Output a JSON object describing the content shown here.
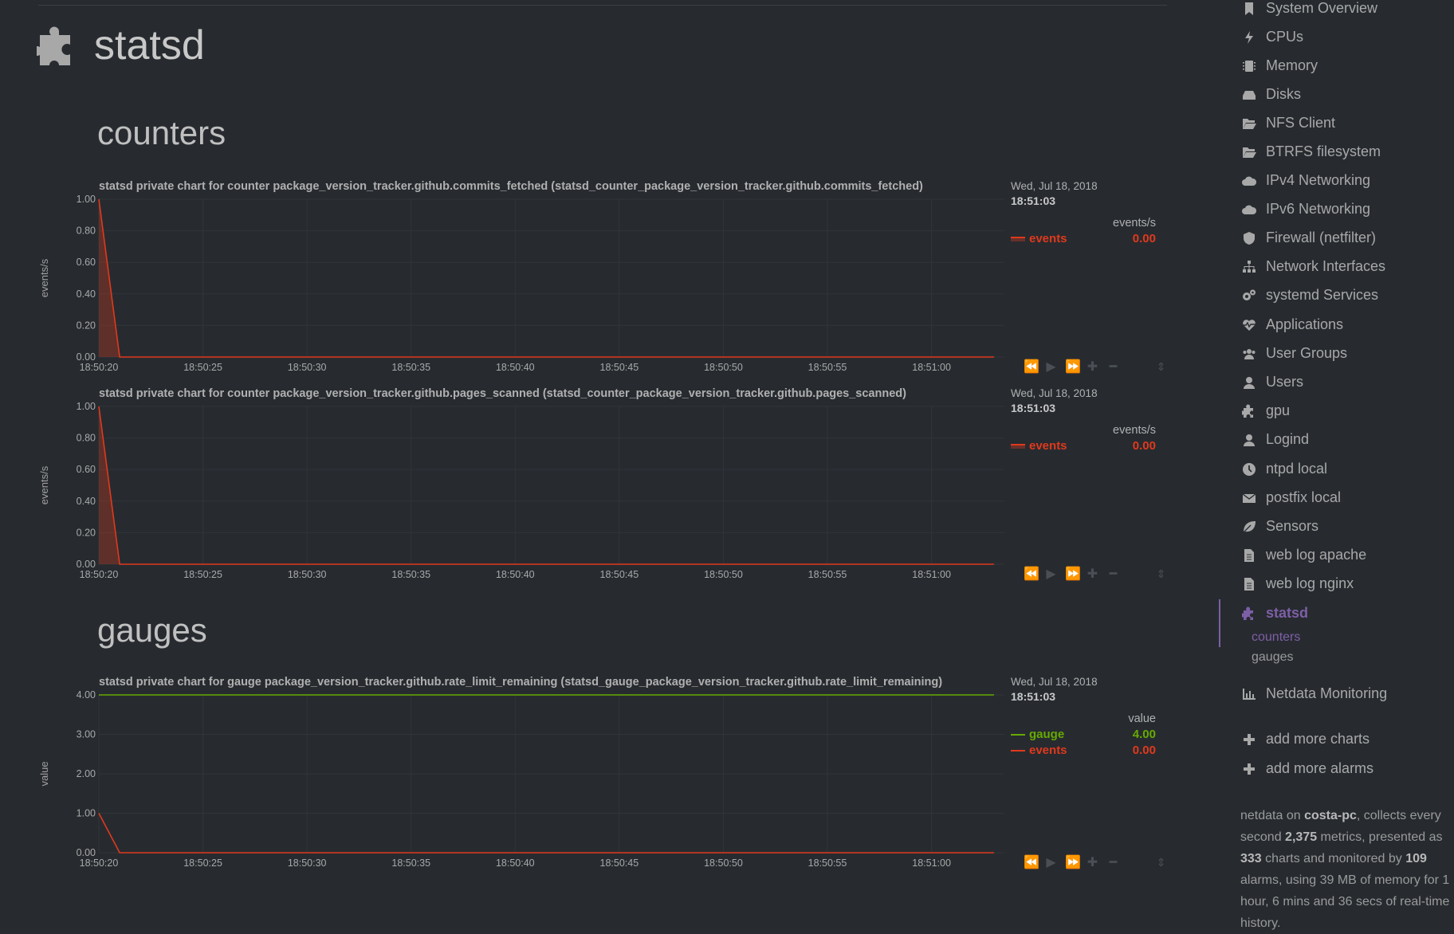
{
  "page": {
    "title": "statsd"
  },
  "sections": {
    "counters": "counters",
    "gauges": "gauges"
  },
  "charts": [
    {
      "title": "statsd private chart for counter package_version_tracker.github.commits_fetched (statsd_counter_package_version_tracker.github.commits_fetched)",
      "ylabel": "events/s",
      "date": "Wed, Jul 18, 2018",
      "time": "18:51:03",
      "units": "events/s",
      "legend": [
        {
          "name": "events",
          "value": "0.00",
          "color": "#e0391c"
        }
      ]
    },
    {
      "title": "statsd private chart for counter package_version_tracker.github.pages_scanned (statsd_counter_package_version_tracker.github.pages_scanned)",
      "ylabel": "events/s",
      "date": "Wed, Jul 18, 2018",
      "time": "18:51:03",
      "units": "events/s",
      "legend": [
        {
          "name": "events",
          "value": "0.00",
          "color": "#e0391c"
        }
      ]
    },
    {
      "title": "statsd private chart for gauge package_version_tracker.github.rate_limit_remaining (statsd_gauge_package_version_tracker.github.rate_limit_remaining)",
      "ylabel": "value",
      "date": "Wed, Jul 18, 2018",
      "time": "18:51:03",
      "units": "value",
      "legend": [
        {
          "name": "gauge",
          "value": "4.00",
          "color": "#66aa00"
        },
        {
          "name": "events",
          "value": "0.00",
          "color": "#e0391c"
        }
      ]
    }
  ],
  "chart_data": [
    {
      "type": "area",
      "ylim": [
        0,
        1
      ],
      "yticks": [
        "0.00",
        "0.20",
        "0.40",
        "0.60",
        "0.80",
        "1.00"
      ],
      "xticks": [
        "18:50:20",
        "18:50:25",
        "18:50:30",
        "18:50:35",
        "18:50:40",
        "18:50:45",
        "18:50:50",
        "18:50:55",
        "18:51:00"
      ],
      "series": [
        {
          "name": "events",
          "color": "#e0391c",
          "x": [
            "18:50:20",
            "18:50:21",
            "18:51:03"
          ],
          "values": [
            1.0,
            0.0,
            0.0
          ]
        }
      ]
    },
    {
      "type": "area",
      "ylim": [
        0,
        1
      ],
      "yticks": [
        "0.00",
        "0.20",
        "0.40",
        "0.60",
        "0.80",
        "1.00"
      ],
      "xticks": [
        "18:50:20",
        "18:50:25",
        "18:50:30",
        "18:50:35",
        "18:50:40",
        "18:50:45",
        "18:50:50",
        "18:50:55",
        "18:51:00"
      ],
      "series": [
        {
          "name": "events",
          "color": "#e0391c",
          "x": [
            "18:50:20",
            "18:50:21",
            "18:51:03"
          ],
          "values": [
            1.0,
            0.0,
            0.0
          ]
        }
      ]
    },
    {
      "type": "line",
      "ylim": [
        0,
        4
      ],
      "yticks": [
        "0.00",
        "1.00",
        "2.00",
        "3.00",
        "4.00"
      ],
      "xticks": [
        "18:50:20",
        "18:50:25",
        "18:50:30",
        "18:50:35",
        "18:50:40",
        "18:50:45",
        "18:50:50",
        "18:50:55",
        "18:51:00"
      ],
      "series": [
        {
          "name": "gauge",
          "color": "#66aa00",
          "x": [
            "18:50:20",
            "18:51:03"
          ],
          "values": [
            4.0,
            4.0
          ]
        },
        {
          "name": "events",
          "color": "#e0391c",
          "x": [
            "18:50:20",
            "18:50:21",
            "18:51:03"
          ],
          "values": [
            1.0,
            0.0,
            0.0
          ]
        }
      ]
    }
  ],
  "sidebar": {
    "items": [
      {
        "label": "System Overview",
        "icon": "bookmark-icon"
      },
      {
        "label": "CPUs",
        "icon": "bolt-icon"
      },
      {
        "label": "Memory",
        "icon": "memory-icon"
      },
      {
        "label": "Disks",
        "icon": "hdd-icon"
      },
      {
        "label": "NFS Client",
        "icon": "folder-open-icon"
      },
      {
        "label": "BTRFS filesystem",
        "icon": "folder-open-icon"
      },
      {
        "label": "IPv4 Networking",
        "icon": "cloud-icon"
      },
      {
        "label": "IPv6 Networking",
        "icon": "cloud-icon"
      },
      {
        "label": "Firewall (netfilter)",
        "icon": "shield-icon"
      },
      {
        "label": "Network Interfaces",
        "icon": "sitemap-icon"
      },
      {
        "label": "systemd Services",
        "icon": "cogs-icon"
      },
      {
        "label": "Applications",
        "icon": "heartbeat-icon"
      },
      {
        "label": "User Groups",
        "icon": "users-icon"
      },
      {
        "label": "Users",
        "icon": "user-icon"
      },
      {
        "label": "gpu",
        "icon": "puzzle-icon"
      },
      {
        "label": "Logind",
        "icon": "user-icon"
      },
      {
        "label": "ntpd local",
        "icon": "clock-icon"
      },
      {
        "label": "postfix local",
        "icon": "envelope-icon"
      },
      {
        "label": "Sensors",
        "icon": "leaf-icon"
      },
      {
        "label": "web log apache",
        "icon": "file-icon"
      },
      {
        "label": "web log nginx",
        "icon": "file-icon"
      },
      {
        "label": "statsd",
        "icon": "puzzle-icon"
      }
    ],
    "sub_items": [
      "counters",
      "gauges"
    ],
    "netdata_monitoring": "Netdata Monitoring",
    "add_charts": "add more charts",
    "add_alarms": "add more alarms",
    "footer": {
      "p1": "netdata on ",
      "host": "costa-pc",
      "p2": ", collects every second ",
      "metrics": "2,375",
      "p3": " metrics, presented as ",
      "charts": "333",
      "p4": " charts and monitored by ",
      "alarms": "109",
      "p5": " alarms, using 39 MB of memory for 1 hour, 6 mins and 36 secs of real-time history."
    }
  }
}
